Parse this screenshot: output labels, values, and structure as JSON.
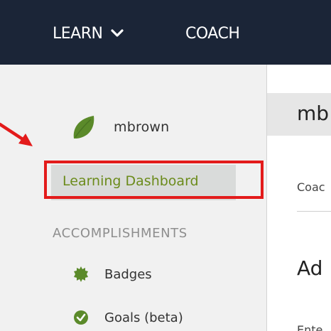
{
  "topnav": {
    "learn_label": "LEARN",
    "coach_label": "COACH",
    "learn_icon": "chevron-down-icon",
    "background": "#1b2537"
  },
  "sidebar": {
    "user": {
      "name": "mbrown",
      "avatar_icon": "leaf-icon",
      "avatar_color": "#5b8a2a"
    },
    "active_item": {
      "label": "Learning Dashboard",
      "color": "#6b8b1b"
    },
    "section_title": "ACCOMPLISHMENTS",
    "items": [
      {
        "label": "Badges",
        "icon": "badge-star-icon"
      },
      {
        "label": "Goals (beta)",
        "icon": "check-circle-icon"
      }
    ]
  },
  "main": {
    "header_text": "mb",
    "subnav_text": "Coac",
    "heading": "Ad",
    "body_text": "Ente"
  },
  "annotation": {
    "highlight_color": "#e31b1b",
    "arrow_color": "#e31b1b"
  }
}
